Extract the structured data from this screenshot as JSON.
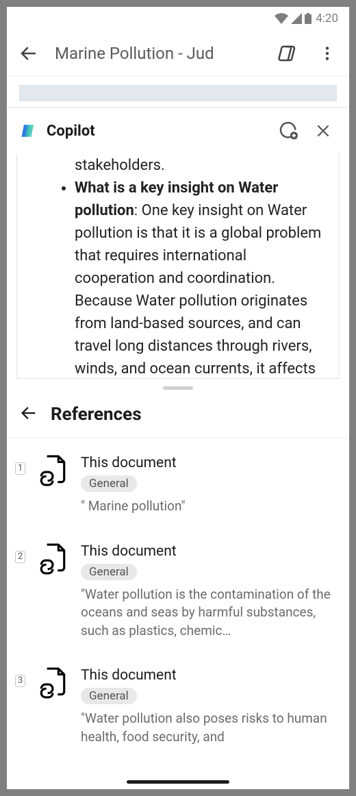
{
  "status": {
    "time": "4:20"
  },
  "app_bar": {
    "title": "Marine Pollution - Jud"
  },
  "copilot": {
    "title": "Copilot",
    "bullets": [
      {
        "lead_fragment": "stakeholders."
      },
      {
        "bold": "What is a key insight on Water pollution",
        "rest": ": One key insight on Water pollution is that it is a global problem that requires international cooperation and coordination. Because Water pollution originates from land-based sources, and can travel long distances through rivers, winds, and ocean currents, it affects regions far from its"
      }
    ]
  },
  "references": {
    "heading": "References",
    "items": [
      {
        "num": "1",
        "title": "This document",
        "tag": "General",
        "excerpt": "\" Marine pollution\""
      },
      {
        "num": "2",
        "title": "This document",
        "tag": "General",
        "excerpt": "\"Water pollution is the contamination of the oceans and seas by harmful substances, such as plastics, chemic…"
      },
      {
        "num": "3",
        "title": "This document",
        "tag": "General",
        "excerpt": "\"Water pollution also poses risks to human health, food security, and"
      }
    ]
  }
}
